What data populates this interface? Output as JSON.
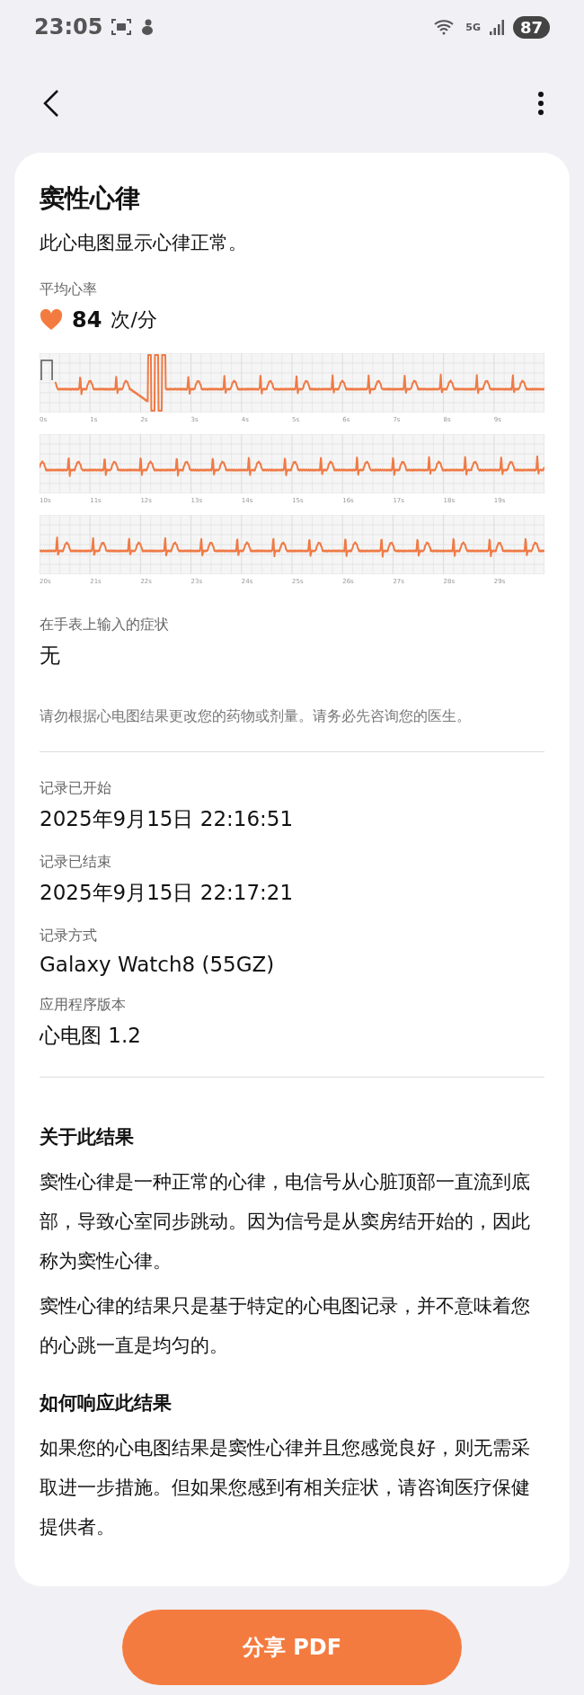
{
  "status_bar": {
    "time": "23:05",
    "network": "5G",
    "battery": "87"
  },
  "title": "窦性心律",
  "subtitle": "此心电图显示心律正常。",
  "heart_rate": {
    "label": "平均心率",
    "value": "84",
    "unit": "次/分"
  },
  "ecg_strips": [
    {
      "ticks": [
        "0s",
        "1s",
        "2s",
        "3s",
        "4s",
        "5s",
        "6s",
        "7s",
        "8s",
        "9s"
      ]
    },
    {
      "ticks": [
        "10s",
        "11s",
        "12s",
        "13s",
        "14s",
        "15s",
        "16s",
        "17s",
        "18s",
        "19s"
      ]
    },
    {
      "ticks": [
        "20s",
        "21s",
        "22s",
        "23s",
        "24s",
        "25s",
        "26s",
        "27s",
        "28s",
        "29s"
      ]
    }
  ],
  "symptoms": {
    "label": "在手表上输入的症状",
    "value": "无"
  },
  "disclaimer": "请勿根据心电图结果更改您的药物或剂量。请务必先咨询您的医生。",
  "records": [
    {
      "label": "记录已开始",
      "value": "2025年9月15日 22:16:51"
    },
    {
      "label": "记录已结束",
      "value": "2025年9月15日 22:17:21"
    },
    {
      "label": "记录方式",
      "value": "Galaxy Watch8 (55GZ)"
    },
    {
      "label": "应用程序版本",
      "value": "心电图 1.2"
    }
  ],
  "sections": [
    {
      "heading": "关于此结果",
      "paragraphs": [
        "窦性心律是一种正常的心律，电信号从心脏顶部一直流到底部，导致心室同步跳动。因为信号是从窦房结开始的，因此称为窦性心律。",
        "窦性心律的结果只是基于特定的心电图记录，并不意味着您的心跳一直是均匀的。"
      ]
    },
    {
      "heading": "如何响应此结果",
      "paragraphs": [
        "如果您的心电图结果是窦性心律并且您感觉良好，则无需采取进一步措施。但如果您感到有相关症状，请咨询医疗保健提供者。"
      ]
    }
  ],
  "share_button": "分享 PDF"
}
